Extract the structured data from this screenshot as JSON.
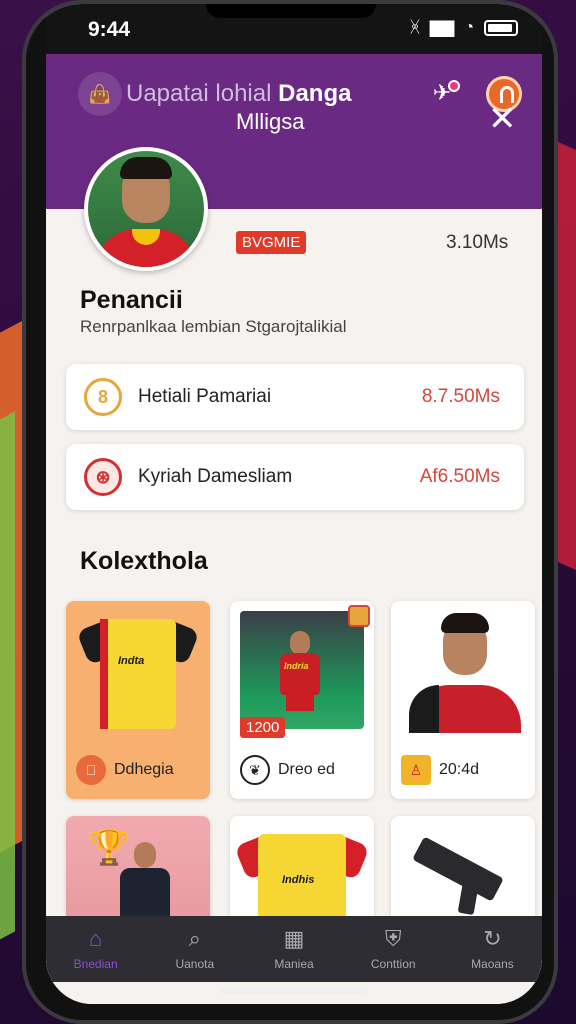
{
  "status_bar": {
    "time": "9:44",
    "icons": [
      "bluetooth-icon",
      "signal-bars-icon",
      "wifi-icon",
      "battery-icon"
    ]
  },
  "header": {
    "title_faded": "Uapatai lohial",
    "title_bold": "Danga",
    "bag_icon": "shopping-bag-icon",
    "notification_icon": "paper-plane-icon",
    "profile_icon": "profile-icon",
    "accent_color": "#6a2a84"
  },
  "profile": {
    "name": "Mlligsa",
    "badge": "BVGMIE",
    "balance": "3.10Ms",
    "close_icon": "close-icon"
  },
  "penancii": {
    "title": "Penancii",
    "subtitle": "Renrpanlkaa lembian Stgarojtalikial"
  },
  "rows": [
    {
      "label": "Hetiali Pamariai",
      "value": "8.7.50Ms",
      "icon": "coin-icon",
      "icon_text": "8"
    },
    {
      "label": "Kyriah Damesliam",
      "value": "Af6.50Ms",
      "icon": "lifebuoy-icon",
      "icon_text": "⊛"
    }
  ],
  "collections": {
    "title": "Kolexthola",
    "items": [
      {
        "label": "Ddhegia",
        "type": "jersey",
        "icon": "bottle-icon",
        "jersey_text": "Indta"
      },
      {
        "label": "Dreo ed",
        "type": "action-photo",
        "tag": "1200",
        "icon": "club-crest-icon",
        "jersey_text": "Indria"
      },
      {
        "label": "20:4d",
        "type": "portrait",
        "icon": "shield-crest-icon"
      },
      {
        "label": "",
        "type": "trophy-photo",
        "icon": "trophy-icon"
      },
      {
        "label": "",
        "type": "jersey",
        "icon": "jersey-icon",
        "jersey_text": "Indhis"
      },
      {
        "label": "",
        "type": "item",
        "icon": "rifle-icon"
      }
    ]
  },
  "bottom_nav": [
    {
      "label": "Bnedian",
      "icon": "home-icon",
      "active": true
    },
    {
      "label": "Uanota",
      "icon": "search-icon",
      "active": false
    },
    {
      "label": "Maniea",
      "icon": "book-icon",
      "active": false
    },
    {
      "label": "Conttion",
      "icon": "shield-icon",
      "active": false
    },
    {
      "label": "Maoans",
      "icon": "refresh-icon",
      "active": false
    }
  ]
}
